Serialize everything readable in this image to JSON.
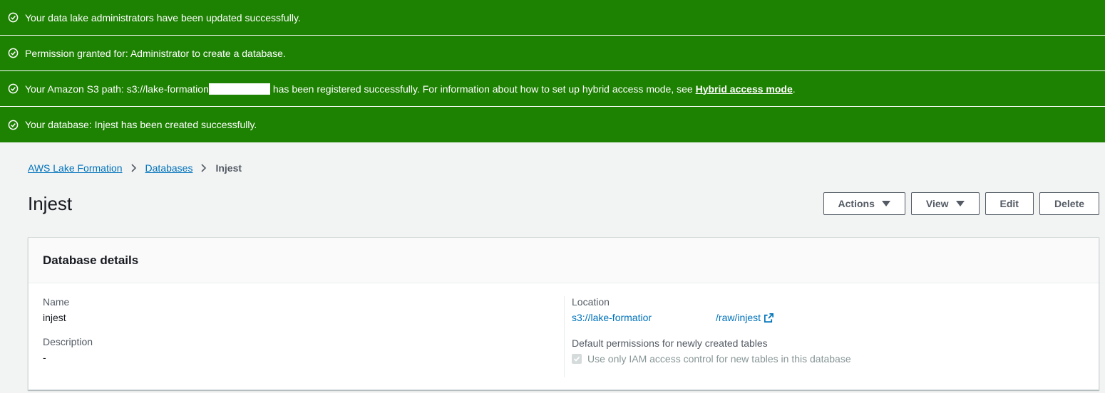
{
  "flashbar": {
    "messages": [
      {
        "text": "Your data lake administrators have been updated successfully."
      },
      {
        "text": "Permission granted for: Administrator to create a database."
      },
      {
        "prefix": "Your Amazon S3 path: s3://lake-formation",
        "middle": "has been registered successfully. For information about how to set up hybrid access mode, see ",
        "link": "Hybrid access mode",
        "suffix": "."
      },
      {
        "text": "Your database: Injest has been created successfully."
      }
    ],
    "icon": "check-circle-icon",
    "color": "#1d8102"
  },
  "breadcrumb": {
    "items": [
      "AWS Lake Formation",
      "Databases"
    ],
    "current": "Injest"
  },
  "page": {
    "title": "Injest",
    "actions_label": "Actions",
    "view_label": "View",
    "edit_label": "Edit",
    "delete_label": "Delete"
  },
  "details": {
    "header": "Database details",
    "name_label": "Name",
    "name_value": "injest",
    "description_label": "Description",
    "description_value": "-",
    "location_label": "Location",
    "location_prefix": "s3://lake-formatior",
    "location_suffix": "/raw/injest",
    "default_perms_label": "Default permissions for newly created tables",
    "iam_checkbox_label": "Use only IAM access control for new tables in this database"
  },
  "colors": {
    "link": "#0073bb",
    "success": "#1d8102"
  }
}
